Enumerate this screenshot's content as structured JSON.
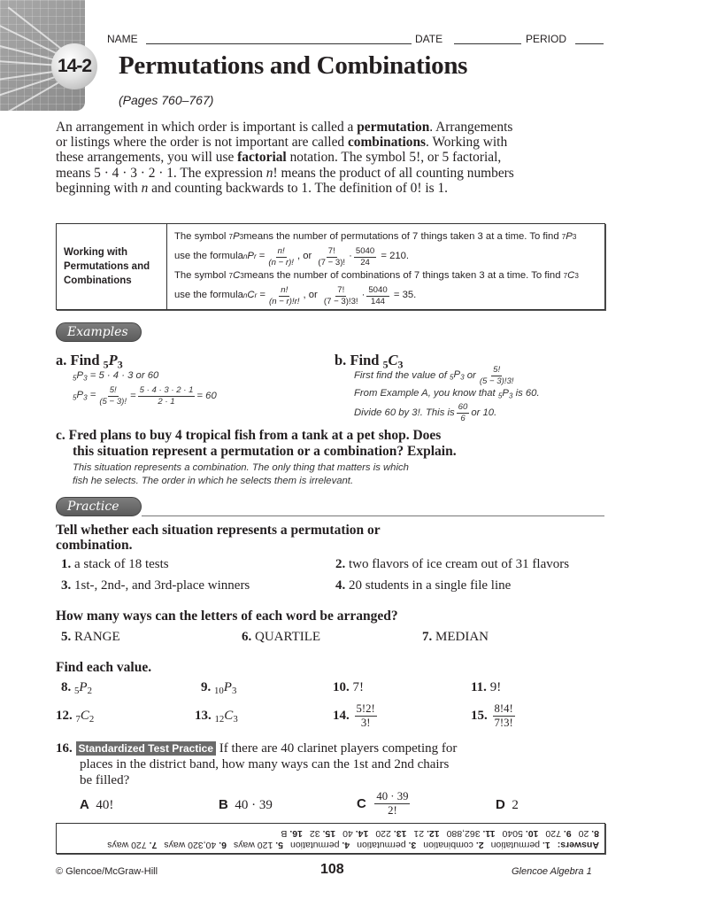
{
  "header": {
    "name_label": "NAME",
    "date_label": "DATE",
    "period_label": "PERIOD",
    "lesson_number": "14-2",
    "title": "Permutations and Combinations",
    "pages": "(Pages 760–767)"
  },
  "intro": {
    "s1_pre": "An arrangement in which order is important is called a ",
    "s1_term": "permutation",
    "s1_post": ".",
    "s2_pre": "Arrangements or listings where the order is not important are called ",
    "s2_term": "combinations",
    "s2_post": ". Working with these arrangements, you will use ",
    "s3_term": "factorial",
    "s3_post": " notation. The symbol 5!, or 5 factorial, means 5 · 4 · 3 · 2 · 1. The expression ",
    "n_var": "n",
    "s4_mid": "! means the product of all counting numbers beginning with ",
    "s4_post": " and counting backwards to 1. The definition of 0! is 1."
  },
  "concept_box": {
    "label": "Working with Permutations and Combinations",
    "perm_line1_pre": "The symbol ",
    "perm_line1_mid": " means the number of permutations of 7 things taken 3 at a time. To find ",
    "perm_formula_pre": "use the formula ",
    "perm_formula_num": "n!",
    "perm_formula_den": "(n − r)!",
    "or": ", or",
    "perm_ex_num": "7!",
    "perm_ex_den": "(7 − 3)!",
    "perm_val_num": "5040",
    "perm_val_den": "24",
    "perm_result": "= 210.",
    "comb_line1_mid": " means the number of combinations of 7 things taken 3 at a time. To find ",
    "comb_formula_den": "(n − r)!r!",
    "comb_ex_den": "(7 − 3)!3!",
    "comb_val_den": "144",
    "comb_result": "= 35.",
    "dot": "·",
    "eq": "="
  },
  "examples": {
    "pill": "Examples",
    "a": {
      "label": "a.",
      "head": "Find",
      "line1": "= 5 · 4 · 3 or 60",
      "num1": "5!",
      "den1": "(5 − 3)!",
      "num2": "5 · 4 · 3 · 2 · 1",
      "den2": "2 · 1",
      "result": "= 60"
    },
    "b": {
      "label": "b.",
      "head": "Find",
      "line1_pre": "First find the value of",
      "line1_or": "or",
      "num1": "5!",
      "den1": "(5 − 3)!3!",
      "line2_pre": "From Example A, you know that",
      "line2_post": "is 60.",
      "line3_pre": "Divide 60 by 3!. This is",
      "num3": "60",
      "den3": "6",
      "line3_post": "or 10."
    },
    "c": {
      "label": "c.",
      "question_line1": "Fred plans to buy 4 tropical fish from a tank at a pet shop. Does",
      "question_line2": "this situation represent a permutation or a combination? Explain.",
      "answer_line1": "This situation represents a combination. The only thing that matters is which",
      "answer_line2": "fish he selects. The order in which he selects them is irrelevant."
    }
  },
  "practice": {
    "pill": "Practice",
    "instruction1_line1": "Tell whether each situation represents a permutation or",
    "instruction1_line2": "combination.",
    "items1": [
      {
        "num": "1.",
        "text": "a stack of 18 tests"
      },
      {
        "num": "2.",
        "text": "two flavors of ice cream out of 31 flavors"
      },
      {
        "num": "3.",
        "text": "1st-, 2nd-, and 3rd-place winners"
      },
      {
        "num": "4.",
        "text": "20 students in a single file line"
      }
    ],
    "instruction2": "How many ways can the letters of each word be arranged?",
    "items2": [
      {
        "num": "5.",
        "text": "RANGE"
      },
      {
        "num": "6.",
        "text": "QUARTILE"
      },
      {
        "num": "7.",
        "text": "MEDIAN"
      }
    ],
    "instruction3": "Find each value.",
    "items3": [
      {
        "num": "8.",
        "pre": "5",
        "letter": "P",
        "post": "2"
      },
      {
        "num": "9.",
        "pre": "10",
        "letter": "P",
        "post": "3"
      },
      {
        "num": "10.",
        "text": "7!"
      },
      {
        "num": "11.",
        "text": "9!"
      },
      {
        "num": "12.",
        "pre": "7",
        "letter": "C",
        "post": "2"
      },
      {
        "num": "13.",
        "pre": "12",
        "letter": "C",
        "post": "3"
      },
      {
        "num": "14.",
        "num_expr": "5!2!",
        "den_expr": "3!"
      },
      {
        "num": "15.",
        "num_expr": "8!4!",
        "den_expr": "7!3!"
      }
    ],
    "q16": {
      "num": "16.",
      "badge": "Standardized Test Practice",
      "line1": "If there are 40 clarinet players competing for",
      "line2": "places in the district band, how many ways can the 1st and 2nd chairs",
      "line3": "be filled?",
      "choices": [
        {
          "letter": "A",
          "text": "40!"
        },
        {
          "letter": "B",
          "text": "40 · 39"
        },
        {
          "letter": "C",
          "num": "40 · 39",
          "den": "2!"
        },
        {
          "letter": "D",
          "text": "2"
        }
      ]
    }
  },
  "answers": {
    "label": "Answers:",
    "row1": [
      {
        "n": "1.",
        "a": "permutation"
      },
      {
        "n": "2.",
        "a": "combination"
      },
      {
        "n": "3.",
        "a": "permutation"
      },
      {
        "n": "4.",
        "a": "permutation"
      },
      {
        "n": "5.",
        "a": "120 ways"
      },
      {
        "n": "6.",
        "a": "40,320 ways"
      },
      {
        "n": "7.",
        "a": "720 ways"
      }
    ],
    "row2": [
      {
        "n": "8.",
        "a": "20"
      },
      {
        "n": "9.",
        "a": "720"
      },
      {
        "n": "10.",
        "a": "5040"
      },
      {
        "n": "11.",
        "a": "362,880"
      },
      {
        "n": "12.",
        "a": "21"
      },
      {
        "n": "13.",
        "a": "220"
      },
      {
        "n": "14.",
        "a": "40"
      },
      {
        "n": "15.",
        "a": "32"
      },
      {
        "n": "16.",
        "a": "B"
      }
    ]
  },
  "footer": {
    "copyright": "© Glencoe/McGraw-Hill",
    "page_number": "108",
    "book": "Glencoe Algebra 1"
  }
}
